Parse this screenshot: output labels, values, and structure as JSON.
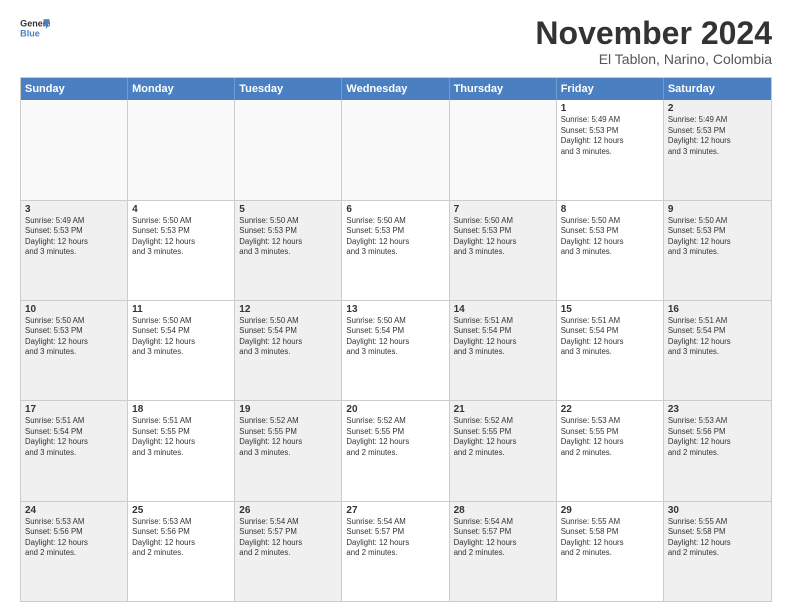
{
  "logo": {
    "line1": "General",
    "line2": "Blue"
  },
  "title": "November 2024",
  "subtitle": "El Tablon, Narino, Colombia",
  "header_days": [
    "Sunday",
    "Monday",
    "Tuesday",
    "Wednesday",
    "Thursday",
    "Friday",
    "Saturday"
  ],
  "rows": [
    [
      {
        "day": "",
        "text": "",
        "empty": true
      },
      {
        "day": "",
        "text": "",
        "empty": true
      },
      {
        "day": "",
        "text": "",
        "empty": true
      },
      {
        "day": "",
        "text": "",
        "empty": true
      },
      {
        "day": "",
        "text": "",
        "empty": true
      },
      {
        "day": "1",
        "text": "Sunrise: 5:49 AM\nSunset: 5:53 PM\nDaylight: 12 hours\nand 3 minutes.",
        "empty": false
      },
      {
        "day": "2",
        "text": "Sunrise: 5:49 AM\nSunset: 5:53 PM\nDaylight: 12 hours\nand 3 minutes.",
        "empty": false
      }
    ],
    [
      {
        "day": "3",
        "text": "Sunrise: 5:49 AM\nSunset: 5:53 PM\nDaylight: 12 hours\nand 3 minutes.",
        "empty": false
      },
      {
        "day": "4",
        "text": "Sunrise: 5:50 AM\nSunset: 5:53 PM\nDaylight: 12 hours\nand 3 minutes.",
        "empty": false
      },
      {
        "day": "5",
        "text": "Sunrise: 5:50 AM\nSunset: 5:53 PM\nDaylight: 12 hours\nand 3 minutes.",
        "empty": false
      },
      {
        "day": "6",
        "text": "Sunrise: 5:50 AM\nSunset: 5:53 PM\nDaylight: 12 hours\nand 3 minutes.",
        "empty": false
      },
      {
        "day": "7",
        "text": "Sunrise: 5:50 AM\nSunset: 5:53 PM\nDaylight: 12 hours\nand 3 minutes.",
        "empty": false
      },
      {
        "day": "8",
        "text": "Sunrise: 5:50 AM\nSunset: 5:53 PM\nDaylight: 12 hours\nand 3 minutes.",
        "empty": false
      },
      {
        "day": "9",
        "text": "Sunrise: 5:50 AM\nSunset: 5:53 PM\nDaylight: 12 hours\nand 3 minutes.",
        "empty": false
      }
    ],
    [
      {
        "day": "10",
        "text": "Sunrise: 5:50 AM\nSunset: 5:53 PM\nDaylight: 12 hours\nand 3 minutes.",
        "empty": false
      },
      {
        "day": "11",
        "text": "Sunrise: 5:50 AM\nSunset: 5:54 PM\nDaylight: 12 hours\nand 3 minutes.",
        "empty": false
      },
      {
        "day": "12",
        "text": "Sunrise: 5:50 AM\nSunset: 5:54 PM\nDaylight: 12 hours\nand 3 minutes.",
        "empty": false
      },
      {
        "day": "13",
        "text": "Sunrise: 5:50 AM\nSunset: 5:54 PM\nDaylight: 12 hours\nand 3 minutes.",
        "empty": false
      },
      {
        "day": "14",
        "text": "Sunrise: 5:51 AM\nSunset: 5:54 PM\nDaylight: 12 hours\nand 3 minutes.",
        "empty": false
      },
      {
        "day": "15",
        "text": "Sunrise: 5:51 AM\nSunset: 5:54 PM\nDaylight: 12 hours\nand 3 minutes.",
        "empty": false
      },
      {
        "day": "16",
        "text": "Sunrise: 5:51 AM\nSunset: 5:54 PM\nDaylight: 12 hours\nand 3 minutes.",
        "empty": false
      }
    ],
    [
      {
        "day": "17",
        "text": "Sunrise: 5:51 AM\nSunset: 5:54 PM\nDaylight: 12 hours\nand 3 minutes.",
        "empty": false
      },
      {
        "day": "18",
        "text": "Sunrise: 5:51 AM\nSunset: 5:55 PM\nDaylight: 12 hours\nand 3 minutes.",
        "empty": false
      },
      {
        "day": "19",
        "text": "Sunrise: 5:52 AM\nSunset: 5:55 PM\nDaylight: 12 hours\nand 3 minutes.",
        "empty": false
      },
      {
        "day": "20",
        "text": "Sunrise: 5:52 AM\nSunset: 5:55 PM\nDaylight: 12 hours\nand 2 minutes.",
        "empty": false
      },
      {
        "day": "21",
        "text": "Sunrise: 5:52 AM\nSunset: 5:55 PM\nDaylight: 12 hours\nand 2 minutes.",
        "empty": false
      },
      {
        "day": "22",
        "text": "Sunrise: 5:53 AM\nSunset: 5:55 PM\nDaylight: 12 hours\nand 2 minutes.",
        "empty": false
      },
      {
        "day": "23",
        "text": "Sunrise: 5:53 AM\nSunset: 5:56 PM\nDaylight: 12 hours\nand 2 minutes.",
        "empty": false
      }
    ],
    [
      {
        "day": "24",
        "text": "Sunrise: 5:53 AM\nSunset: 5:56 PM\nDaylight: 12 hours\nand 2 minutes.",
        "empty": false
      },
      {
        "day": "25",
        "text": "Sunrise: 5:53 AM\nSunset: 5:56 PM\nDaylight: 12 hours\nand 2 minutes.",
        "empty": false
      },
      {
        "day": "26",
        "text": "Sunrise: 5:54 AM\nSunset: 5:57 PM\nDaylight: 12 hours\nand 2 minutes.",
        "empty": false
      },
      {
        "day": "27",
        "text": "Sunrise: 5:54 AM\nSunset: 5:57 PM\nDaylight: 12 hours\nand 2 minutes.",
        "empty": false
      },
      {
        "day": "28",
        "text": "Sunrise: 5:54 AM\nSunset: 5:57 PM\nDaylight: 12 hours\nand 2 minutes.",
        "empty": false
      },
      {
        "day": "29",
        "text": "Sunrise: 5:55 AM\nSunset: 5:58 PM\nDaylight: 12 hours\nand 2 minutes.",
        "empty": false
      },
      {
        "day": "30",
        "text": "Sunrise: 5:55 AM\nSunset: 5:58 PM\nDaylight: 12 hours\nand 2 minutes.",
        "empty": false
      }
    ]
  ]
}
